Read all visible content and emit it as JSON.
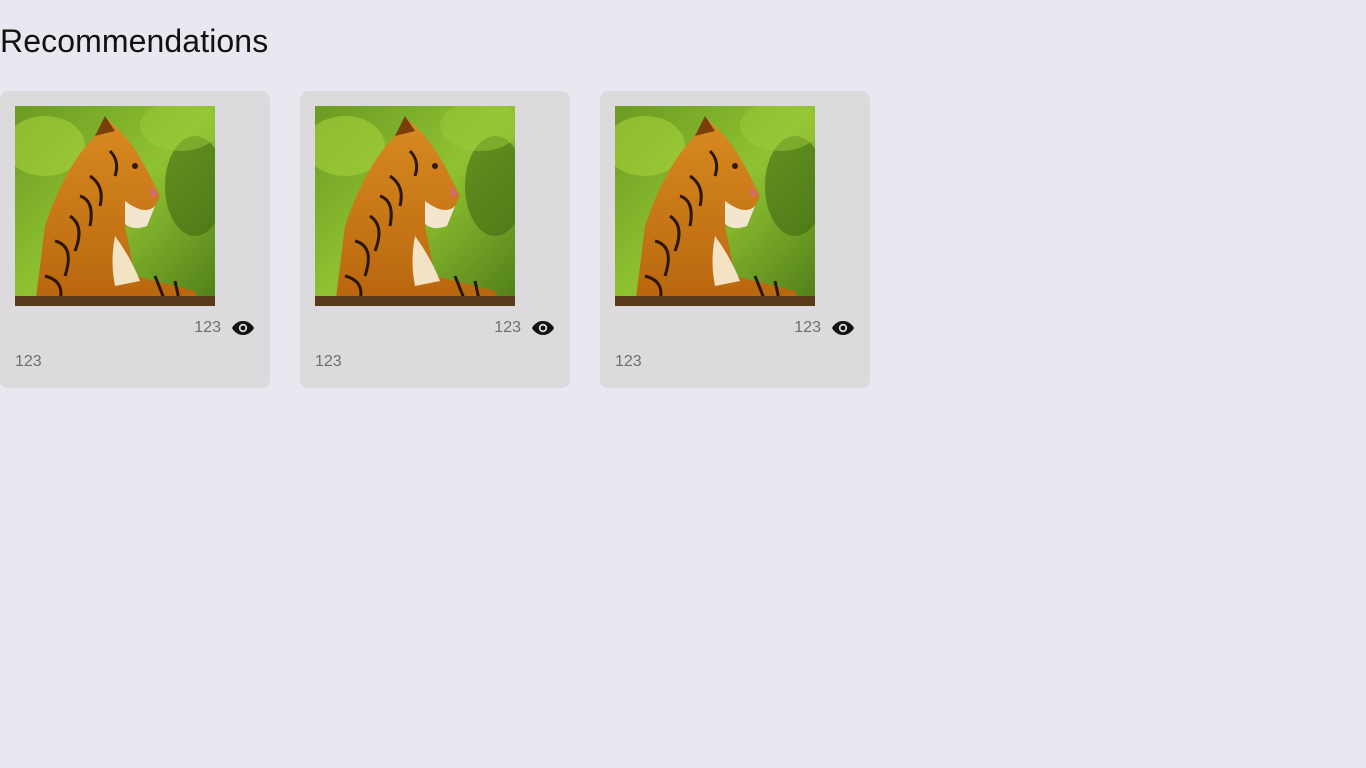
{
  "header": {
    "title": "Recommendations"
  },
  "icons": {
    "views": "eye-icon"
  },
  "cards": [
    {
      "views": "123",
      "caption": "123",
      "image": "tiger-photo"
    },
    {
      "views": "123",
      "caption": "123",
      "image": "tiger-photo"
    },
    {
      "views": "123",
      "caption": "123",
      "image": "tiger-photo"
    }
  ]
}
